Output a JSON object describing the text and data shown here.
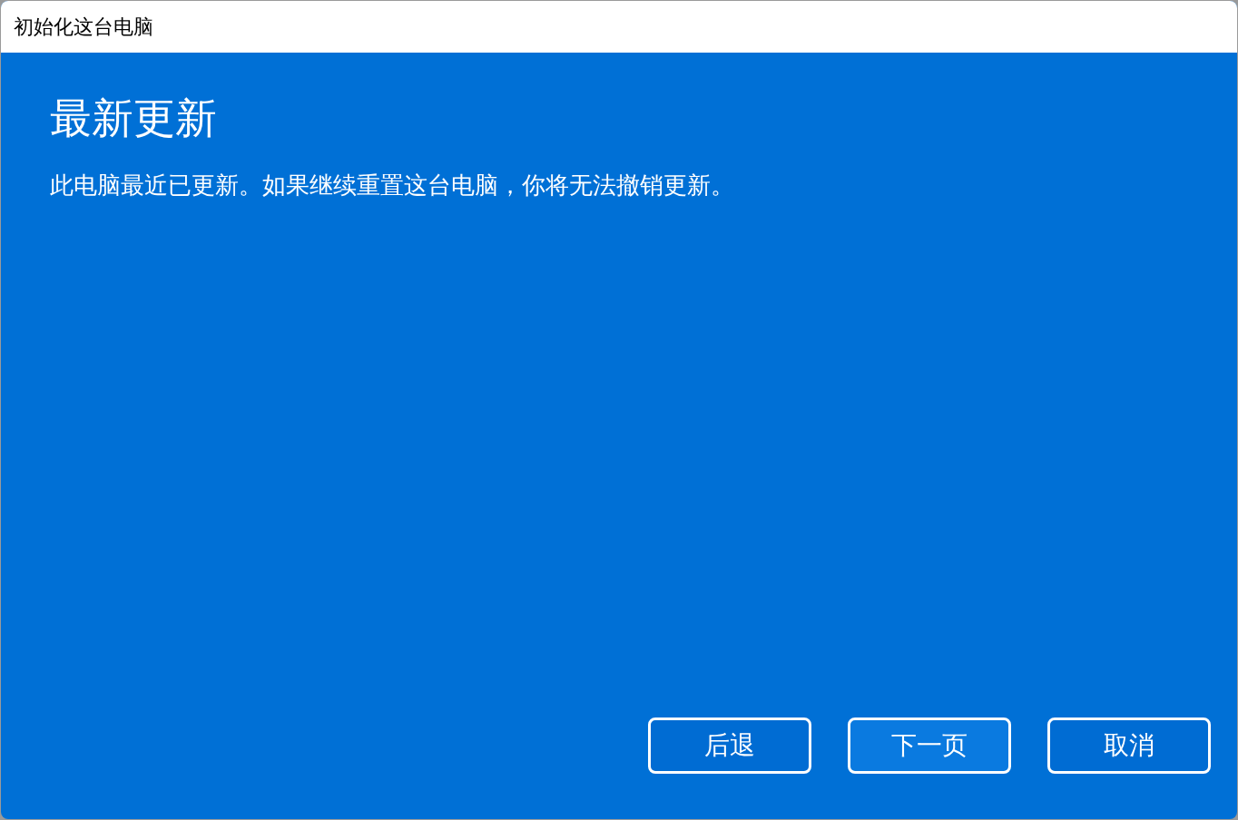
{
  "window": {
    "title": "初始化这台电脑"
  },
  "heading": "最新更新",
  "message": "此电脑最近已更新。如果继续重置这台电脑，你将无法撤销更新。",
  "buttons": [
    {
      "label": "后退",
      "focused": false
    },
    {
      "label": "下一页",
      "focused": true
    },
    {
      "label": "取消",
      "focused": false
    }
  ]
}
